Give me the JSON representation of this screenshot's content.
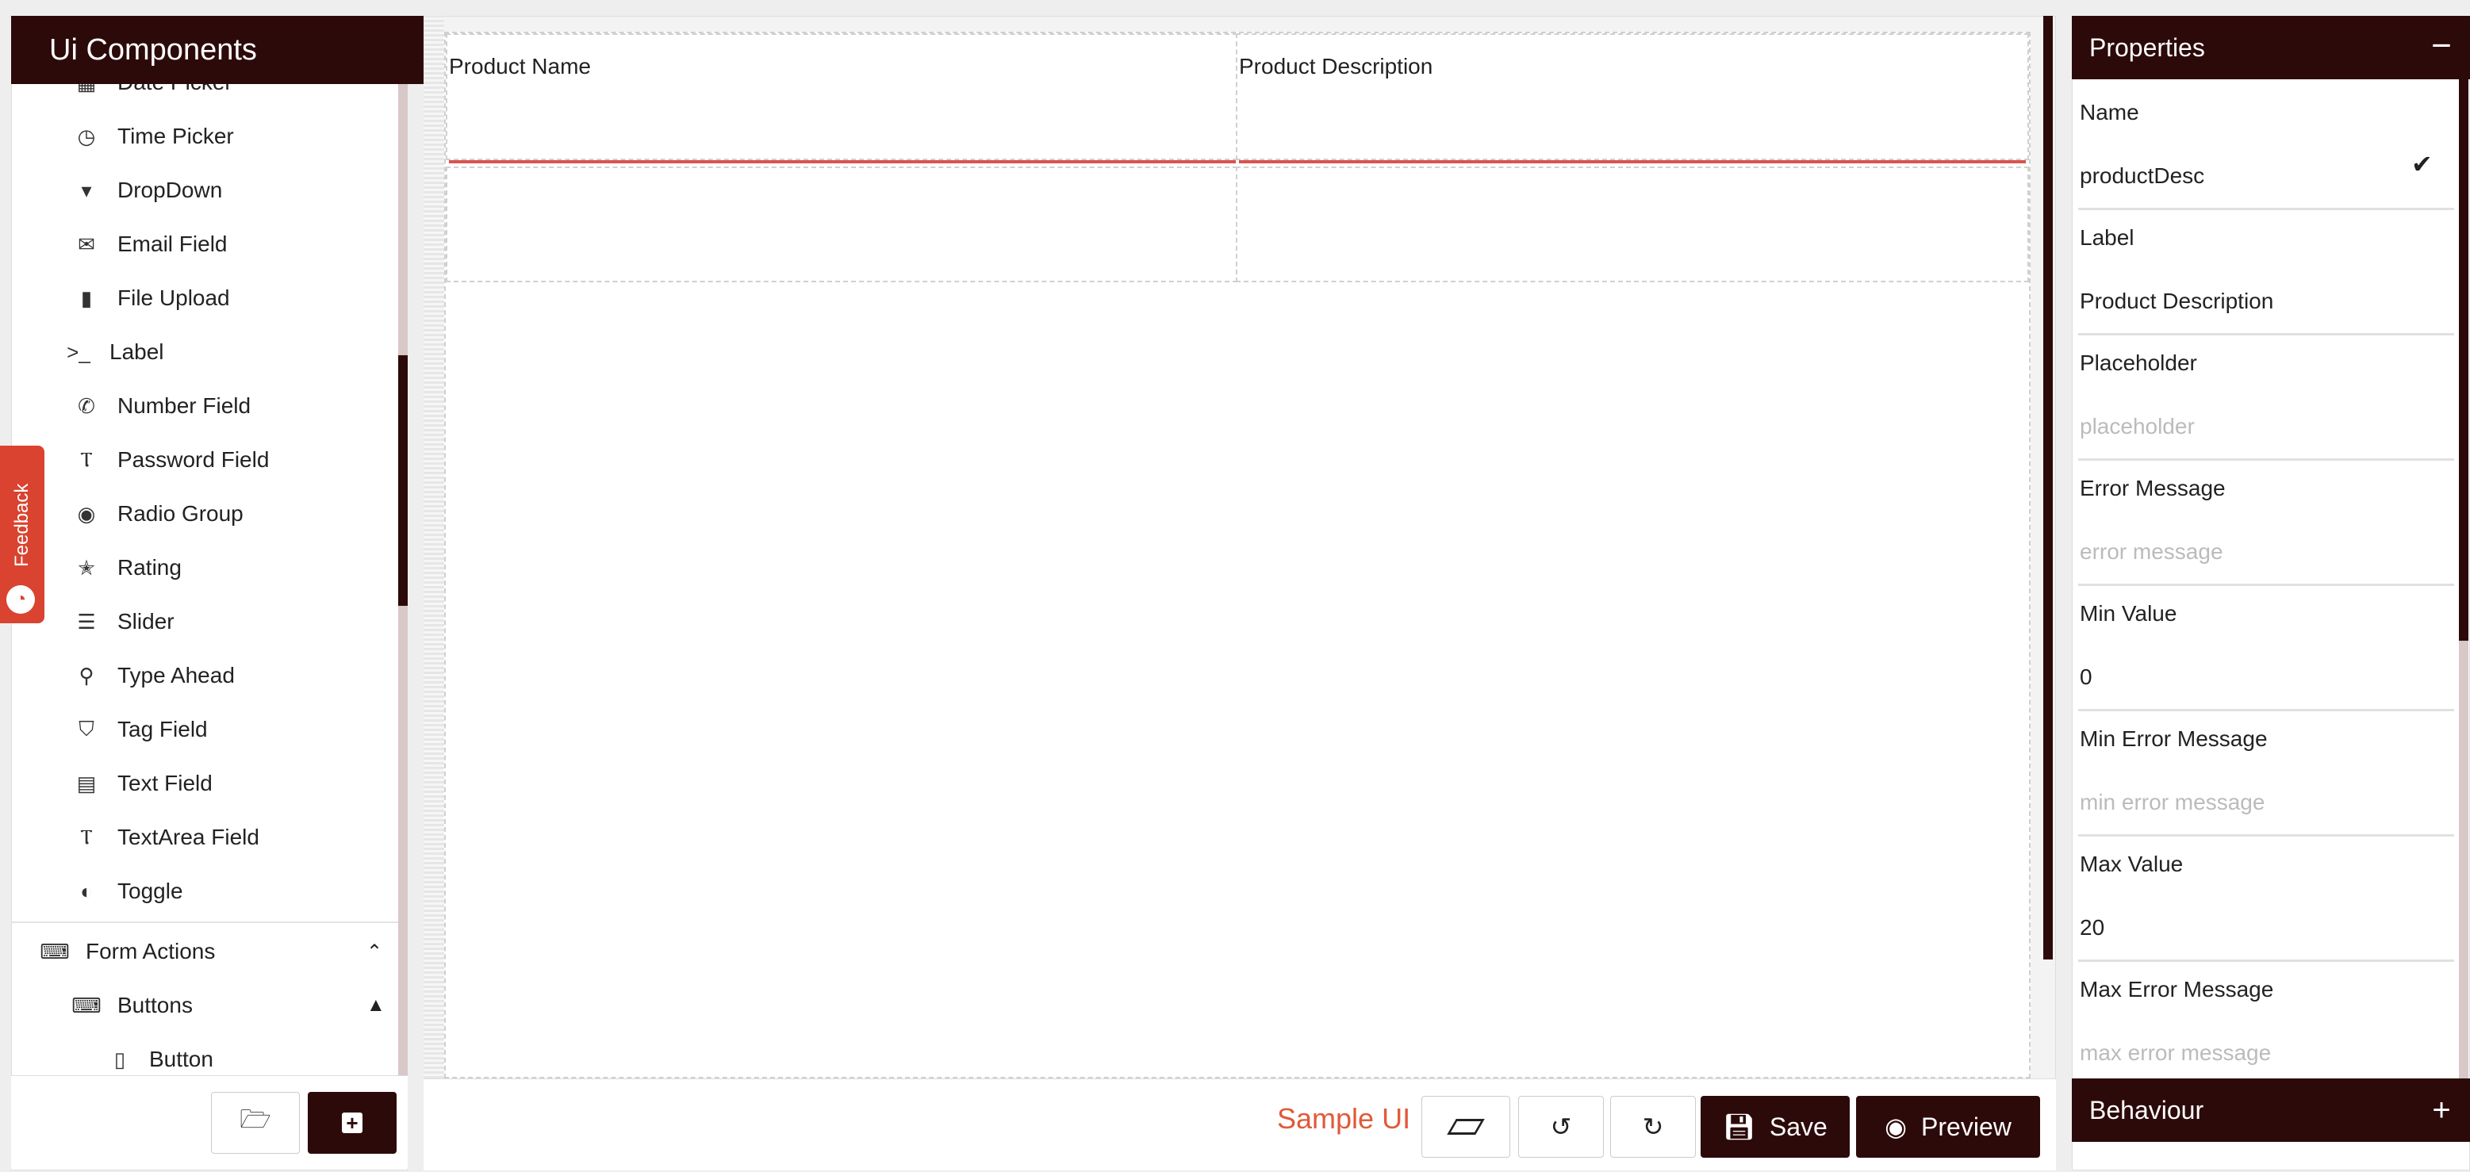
{
  "left_panel": {
    "title": "Ui Components",
    "items": [
      {
        "label": "Date Picker",
        "icon": "calendar-icon",
        "glyph": "▦"
      },
      {
        "label": "Time Picker",
        "icon": "clock-icon",
        "glyph": "◷"
      },
      {
        "label": "DropDown",
        "icon": "dropdown-icon",
        "glyph": "▾"
      },
      {
        "label": "Email Field",
        "icon": "envelope-icon",
        "glyph": "✉"
      },
      {
        "label": "File Upload",
        "icon": "file-icon",
        "glyph": "▮"
      },
      {
        "label": "Label",
        "icon": "terminal-icon",
        "glyph": ">_"
      },
      {
        "label": "Number Field",
        "icon": "phone-icon",
        "glyph": "✆"
      },
      {
        "label": "Password Field",
        "icon": "text-cursor-icon",
        "glyph": "Ⲧ"
      },
      {
        "label": "Radio Group",
        "icon": "radio-icon",
        "glyph": "◉"
      },
      {
        "label": "Rating",
        "icon": "star-half-icon",
        "glyph": "✭"
      },
      {
        "label": "Slider",
        "icon": "sliders-icon",
        "glyph": "☰"
      },
      {
        "label": "Type Ahead",
        "icon": "search-icon",
        "glyph": "⚲"
      },
      {
        "label": "Tag Field",
        "icon": "tags-icon",
        "glyph": "⛉"
      },
      {
        "label": "Text Field",
        "icon": "file-text-icon",
        "glyph": "▤"
      },
      {
        "label": "TextArea Field",
        "icon": "text-cursor-icon",
        "glyph": "Ⲧ"
      },
      {
        "label": "Toggle",
        "icon": "toggle-icon",
        "glyph": "◐"
      }
    ],
    "form_actions": {
      "label": "Form Actions",
      "icon": "keyboard-icon",
      "glyph": "⌨",
      "chevron": "chevron-up-icon"
    },
    "buttons_group": {
      "label": "Buttons",
      "icon": "keyboard-icon",
      "glyph": "⌨",
      "chevron": "caret-up-icon"
    },
    "button_item": {
      "label": "Button",
      "icon": "tablet-icon",
      "glyph": "▯"
    }
  },
  "feedback": {
    "label": "Feedback"
  },
  "canvas": {
    "columns": [
      "Product Name",
      "Product Description"
    ]
  },
  "bottom_bar": {
    "title": "Sample UI",
    "save_label": "Save",
    "preview_label": "Preview"
  },
  "properties": {
    "title": "Properties",
    "fields": [
      {
        "label": "Name",
        "value": "productDesc",
        "placeholder": false
      },
      {
        "label": "Label",
        "value": "Product Description",
        "placeholder": false
      },
      {
        "label": "Placeholder",
        "value": "placeholder",
        "placeholder": true
      },
      {
        "label": "Error Message",
        "value": "error message",
        "placeholder": true
      },
      {
        "label": "Min Value",
        "value": "0",
        "placeholder": false
      },
      {
        "label": "Min Error Message",
        "value": "min error message",
        "placeholder": true
      },
      {
        "label": "Max Value",
        "value": "20",
        "placeholder": false
      },
      {
        "label": "Max Error Message",
        "value": "max error message",
        "placeholder": true
      }
    ],
    "behaviour_label": "Behaviour"
  },
  "colors": {
    "brand_dark": "#2d0a0a",
    "accent_red": "#d9432f",
    "sample_ui": "#e05a3a"
  }
}
